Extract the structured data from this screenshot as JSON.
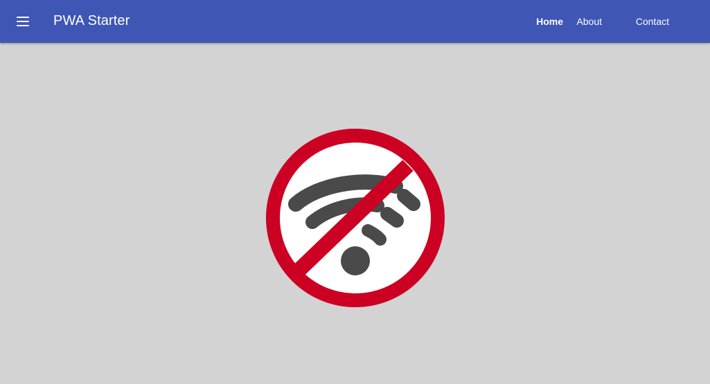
{
  "header": {
    "menu_icon": "menu-hamburger-icon",
    "title": "PWA Starter",
    "nav": [
      {
        "label": "Home",
        "active": true
      },
      {
        "label": "About",
        "active": false
      },
      {
        "label": "Contact",
        "active": false
      }
    ],
    "background_color": "#3f56b5"
  },
  "main": {
    "background_color": "#d3d3d3",
    "offline_icon": "no-wifi-icon",
    "prohibition_color": "#cc0022",
    "wifi_color": "#4a4a4a"
  }
}
